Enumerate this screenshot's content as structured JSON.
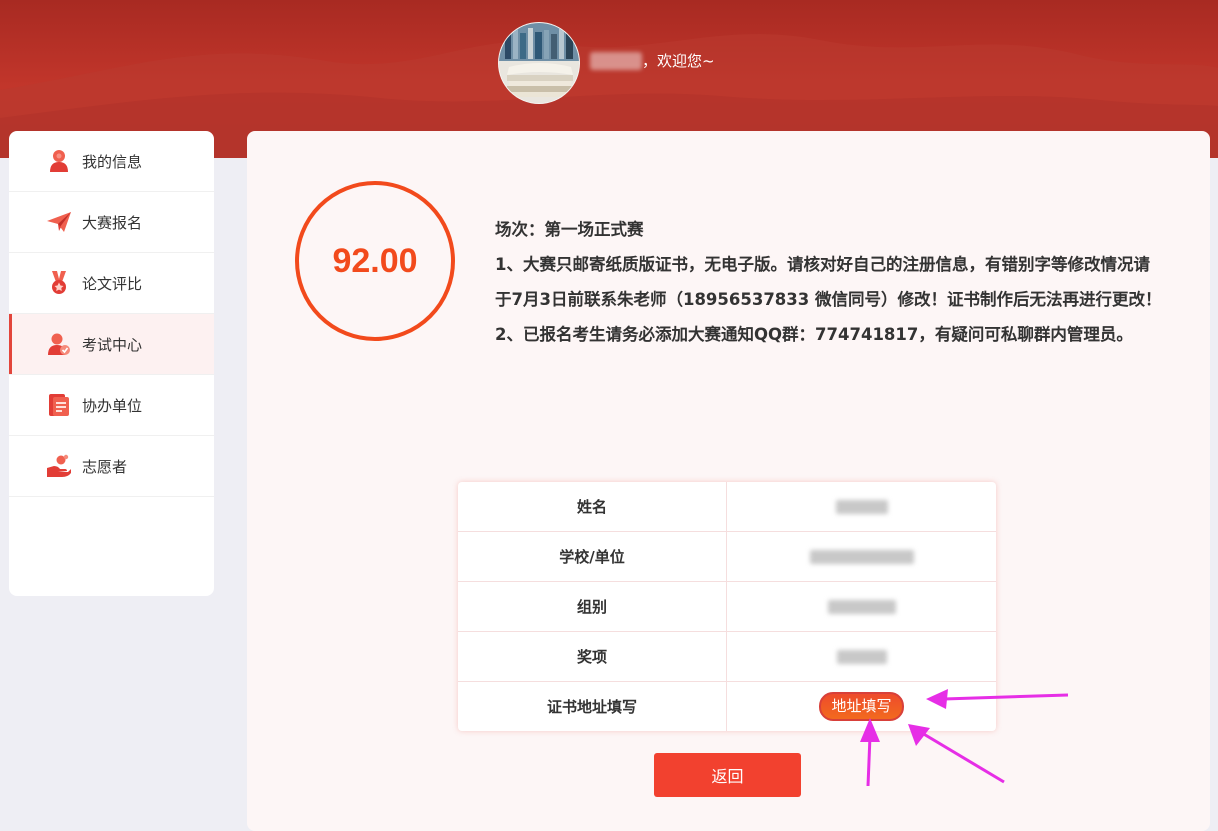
{
  "header": {
    "welcome_text": "，欢迎您~",
    "avatar_icon": "books-avatar-icon"
  },
  "sidebar": {
    "items": [
      {
        "label": "我的信息",
        "icon": "person-icon",
        "active": false
      },
      {
        "label": "大赛报名",
        "icon": "paper-plane-icon",
        "active": false
      },
      {
        "label": "论文评比",
        "icon": "medal-icon",
        "active": false
      },
      {
        "label": "考试中心",
        "icon": "user-exam-icon",
        "active": true
      },
      {
        "label": "协办单位",
        "icon": "document-icon",
        "active": false
      },
      {
        "label": "志愿者",
        "icon": "hand-heart-icon",
        "active": false
      }
    ]
  },
  "score": {
    "value": "92.00"
  },
  "notice": {
    "session": "场次：第一场正式赛",
    "line1": "1、大赛只邮寄纸质版证书，无电子版。请核对好自己的注册信息，有错别字等修改情况请于7月3日前联系朱老师（18956537833 微信同号）修改！证书制作后无法再进行更改！",
    "line2": "2、已报名考生请务必添加大赛通知QQ群：774741817，有疑问可私聊群内管理员。"
  },
  "table": {
    "rows": [
      {
        "key": "姓名"
      },
      {
        "key": "学校/单位"
      },
      {
        "key": "组别"
      },
      {
        "key": "奖项"
      },
      {
        "key": "证书地址填写"
      }
    ],
    "address_button": "地址填写"
  },
  "back_button": "返回",
  "colors": {
    "brand_red": "#c2362b",
    "accent_orange": "#f24a1c",
    "annotation_magenta": "#e62ee6"
  }
}
